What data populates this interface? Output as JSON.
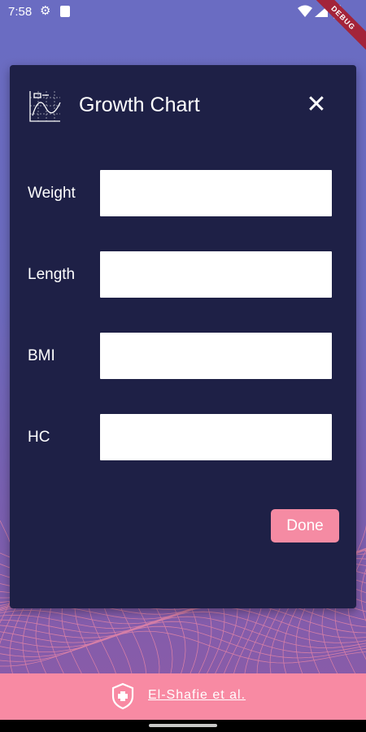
{
  "status_bar": {
    "time": "7:58",
    "icons": [
      "gear-icon",
      "sd-card-icon",
      "wifi-icon",
      "signal-icon",
      "battery-icon"
    ]
  },
  "debug_banner": "DEBUG",
  "dialog": {
    "title": "Growth Chart",
    "icon": "growth-chart-icon",
    "close_symbol": "✕",
    "fields": [
      {
        "label": "Weight",
        "value": "",
        "placeholder": ""
      },
      {
        "label": "Length",
        "value": "",
        "placeholder": ""
      },
      {
        "label": "BMI",
        "value": "",
        "placeholder": ""
      },
      {
        "label": "HC",
        "value": "",
        "placeholder": ""
      }
    ],
    "done_label": "Done"
  },
  "footer": {
    "icon": "shield-cross-icon",
    "link_text": "El-Shafie et al."
  },
  "colors": {
    "dialog_bg": "#1e2046",
    "accent": "#f58ba3",
    "footer_bg": "#f88aa3",
    "background_top": "#6a6cc2",
    "background_bottom": "#8d5aa6"
  }
}
